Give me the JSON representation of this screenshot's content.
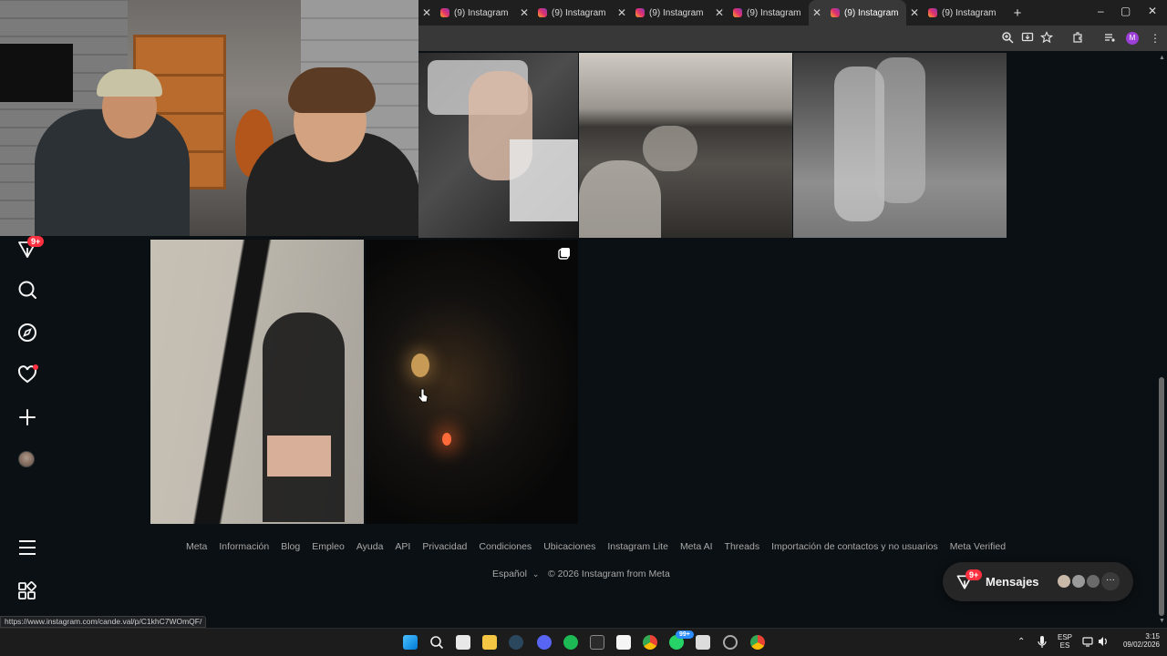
{
  "browser": {
    "tabs": [
      {
        "title": "(9) Instagram",
        "active": false
      },
      {
        "title": "(9) Instagram",
        "active": false
      },
      {
        "title": "(9) Instagram",
        "active": false
      },
      {
        "title": "(9) Instagram",
        "active": false
      },
      {
        "title": "(9) Instagram",
        "active": true
      },
      {
        "title": "(9) Instagram",
        "active": false
      }
    ],
    "new_tab": "+",
    "window_controls": {
      "minimize": "–",
      "maximize": "▢",
      "close": "✕"
    },
    "profile_initial": "M",
    "status_url": "https://www.instagram.com/cande.val/p/C1khC7WOmQF/"
  },
  "sidebar": {
    "messages_badge": "9+",
    "items": [
      {
        "name": "messages-icon"
      },
      {
        "name": "search-icon"
      },
      {
        "name": "explore-icon"
      },
      {
        "name": "notifications-icon"
      },
      {
        "name": "create-icon"
      },
      {
        "name": "profile-avatar"
      },
      {
        "name": "menu-icon"
      },
      {
        "name": "more-apps-icon"
      }
    ]
  },
  "footer": {
    "links": [
      "Meta",
      "Información",
      "Blog",
      "Empleo",
      "Ayuda",
      "API",
      "Privacidad",
      "Condiciones",
      "Ubicaciones",
      "Instagram Lite",
      "Meta AI",
      "Threads",
      "Importación de contactos y no usuarios",
      "Meta Verified"
    ],
    "language": "Español",
    "copyright": "© 2026 Instagram from Meta"
  },
  "messages_pill": {
    "label": "Mensajes",
    "badge": "9+",
    "more": "···"
  },
  "taskbar": {
    "lang_top": "ESP",
    "lang_bottom": "ES",
    "time": "3:15",
    "date": "09/02/2026",
    "whatsapp_badge": "99+"
  }
}
